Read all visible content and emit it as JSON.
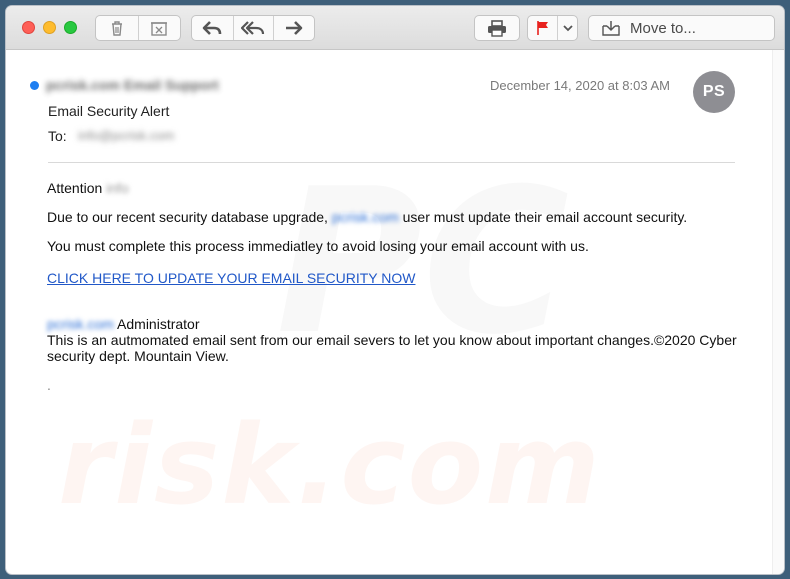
{
  "toolbar": {
    "move_to_label": "Move to..."
  },
  "email": {
    "sender": "pcrisk.com Email Support",
    "subject": "Email Security Alert",
    "to_label": "To:",
    "to_value": "info@pcrisk.com",
    "date": "December 14, 2020 at 8:03 AM",
    "avatar_initials": "PS"
  },
  "body": {
    "attention_word": "Attention",
    "attention_name": "info",
    "line1_prefix": "Due to our recent security database upgrade,",
    "line1_domain": "pcrisk.com",
    "line1_suffix": "user must update their email account security.",
    "line2": "You must complete this process immediatley to avoid losing your email account with us.",
    "link_text": "CLICK HERE TO UPDATE YOUR EMAIL SECURITY NOW",
    "sig_domain": "pcrisk.com",
    "sig_role": "Administrator",
    "footer_line1": "This is an autmomated email sent from our email severs to let you know about important changes.©2020 Cyber",
    "footer_line2": "security dept. Mountain View.",
    "trailing": "."
  },
  "watermark": {
    "text_big": "PC",
    "text_small": "risk.com"
  },
  "colors": {
    "unread_dot": "#1f7ff1",
    "flag": "#e8221e",
    "link": "#2158c8",
    "avatar": "#8e8e93"
  },
  "icons": {
    "delete": "trash-icon",
    "junk": "junk-icon",
    "reply": "reply-icon",
    "reply_all": "reply-all-icon",
    "forward": "forward-icon",
    "print": "print-icon",
    "flag": "flag-icon",
    "dropdown": "chevron-down-icon",
    "move": "move-to-icon"
  }
}
